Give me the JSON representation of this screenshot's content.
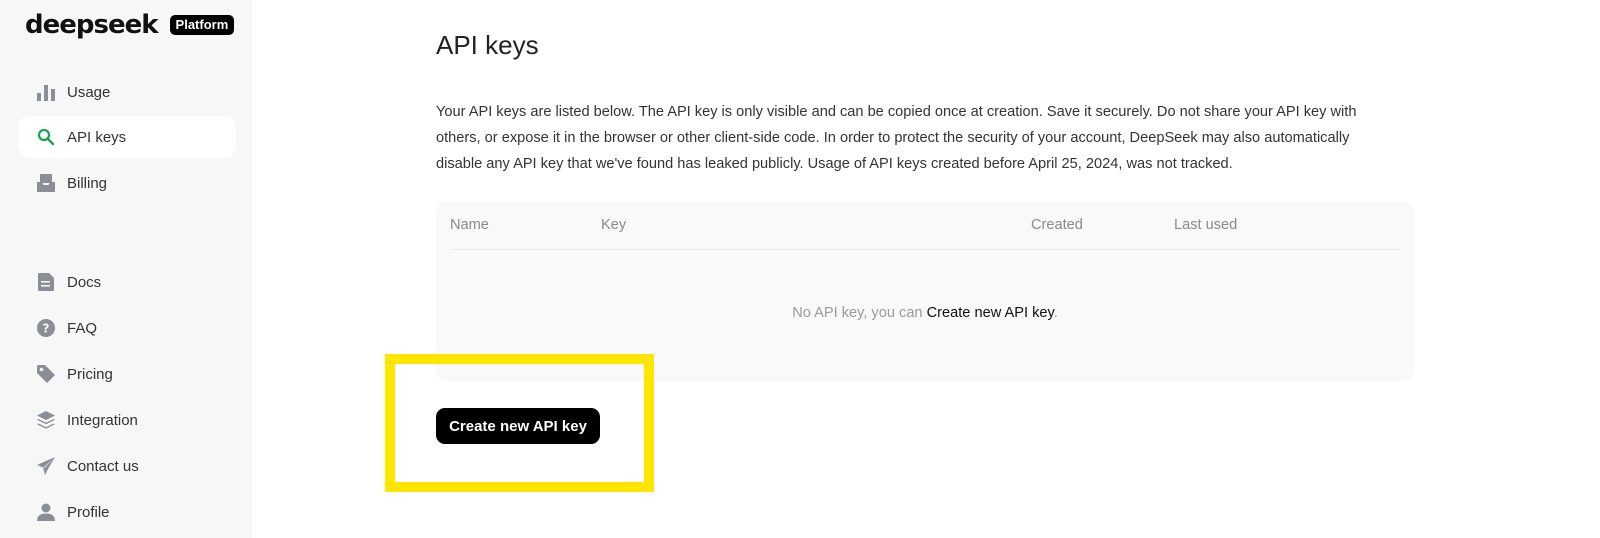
{
  "brand": {
    "name": "deepseek",
    "badge": "Platform"
  },
  "sidebar": {
    "items": [
      {
        "label": "Usage",
        "icon": "bar-chart-icon",
        "active": false
      },
      {
        "label": "API keys",
        "icon": "key-search-icon",
        "active": true
      },
      {
        "label": "Billing",
        "icon": "billing-icon",
        "active": false
      },
      {
        "label": "Docs",
        "icon": "document-icon",
        "active": false
      },
      {
        "label": "FAQ",
        "icon": "question-icon",
        "active": false
      },
      {
        "label": "Pricing",
        "icon": "tag-icon",
        "active": false
      },
      {
        "label": "Integration",
        "icon": "layers-icon",
        "active": false
      },
      {
        "label": "Contact us",
        "icon": "send-icon",
        "active": false
      },
      {
        "label": "Profile",
        "icon": "user-icon",
        "active": false
      }
    ]
  },
  "main": {
    "title": "API keys",
    "description": "Your API keys are listed below. The API key is only visible and can be copied once at creation. Save it securely. Do not share your API key with others, or expose it in the browser or other client-side code. In order to protect the security of your account, DeepSeek may also automatically disable any API key that we've found has leaked publicly. Usage of API keys created before April 25, 2024, was not tracked.",
    "table": {
      "columns": [
        "Name",
        "Key",
        "Created",
        "Last used"
      ],
      "empty_prefix": "No API key, you can ",
      "empty_link": "Create new API key",
      "empty_suffix": "."
    },
    "create_button": "Create new API key"
  },
  "colors": {
    "accent_green": "#1aa34a",
    "highlight": "#ffe600",
    "button_bg": "#000000",
    "sidebar_bg": "#f7f7f7"
  }
}
